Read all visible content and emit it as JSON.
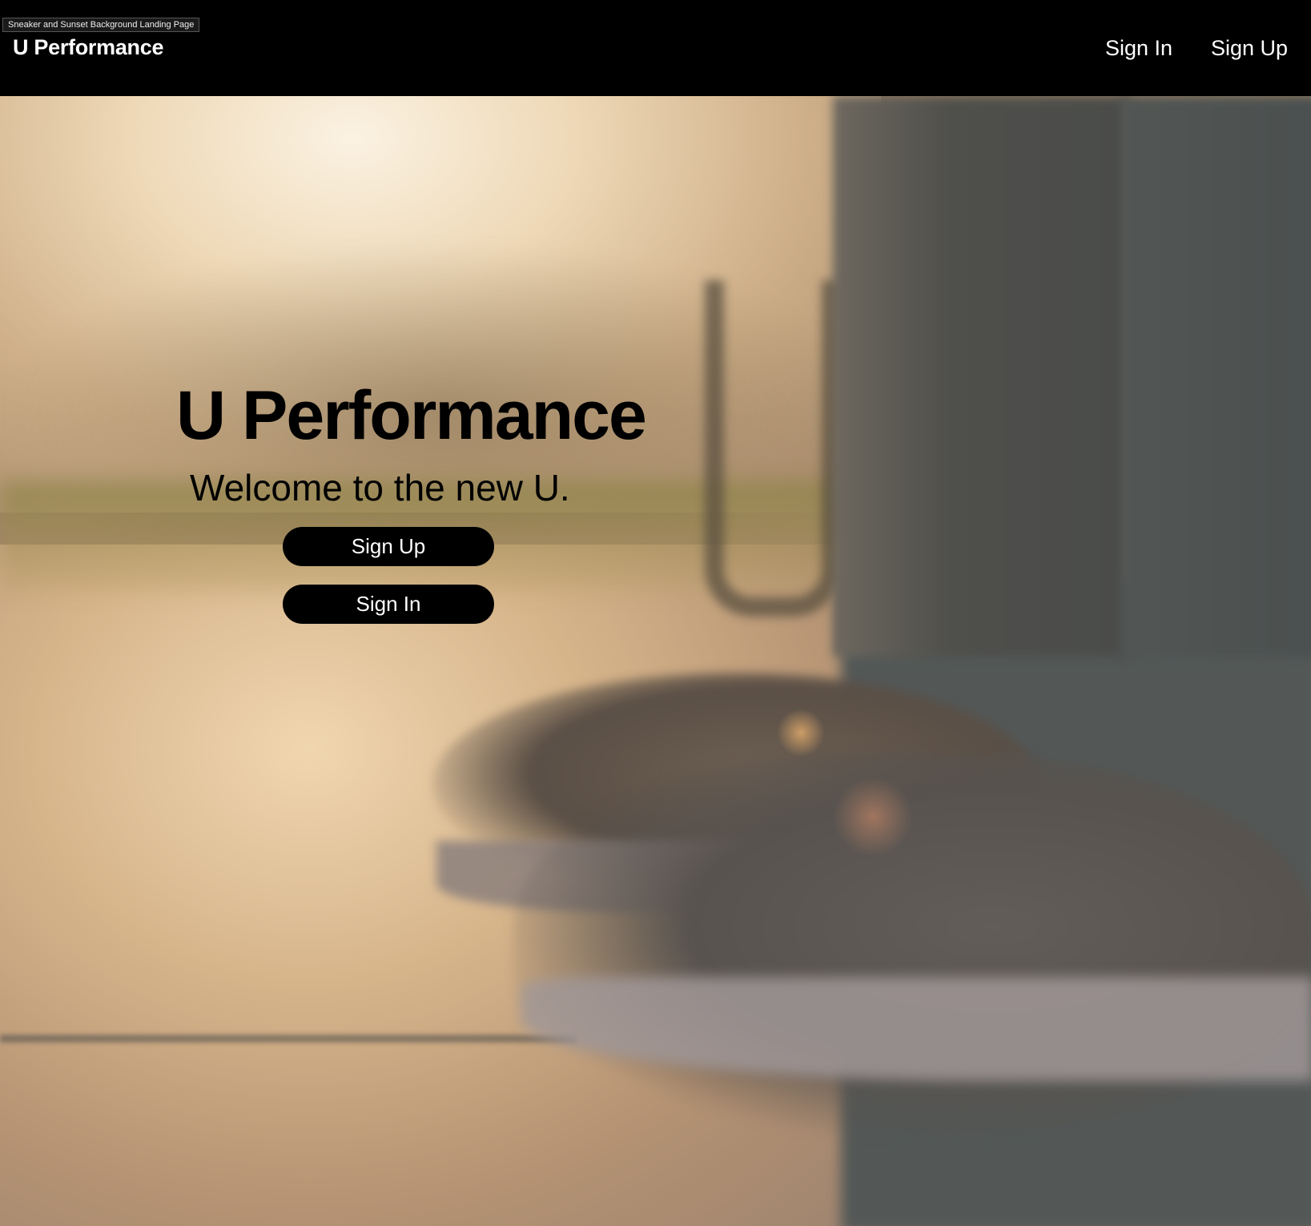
{
  "window": {
    "tab_caption": "Sneaker and Sunset Background Landing Page"
  },
  "navbar": {
    "brand": "U Performance",
    "links": [
      {
        "label": "Sign In"
      },
      {
        "label": "Sign Up"
      }
    ],
    "background_color": "#000000",
    "text_color": "#ffffff"
  },
  "hero": {
    "title": "U Performance",
    "subtitle": "Welcome to the new U.",
    "buttons": [
      {
        "label": "Sign Up"
      },
      {
        "label": "Sign In"
      }
    ],
    "button_color": "#000000",
    "button_text_color": "#ffffff",
    "background_image": "blurred sneakers at sunset"
  }
}
